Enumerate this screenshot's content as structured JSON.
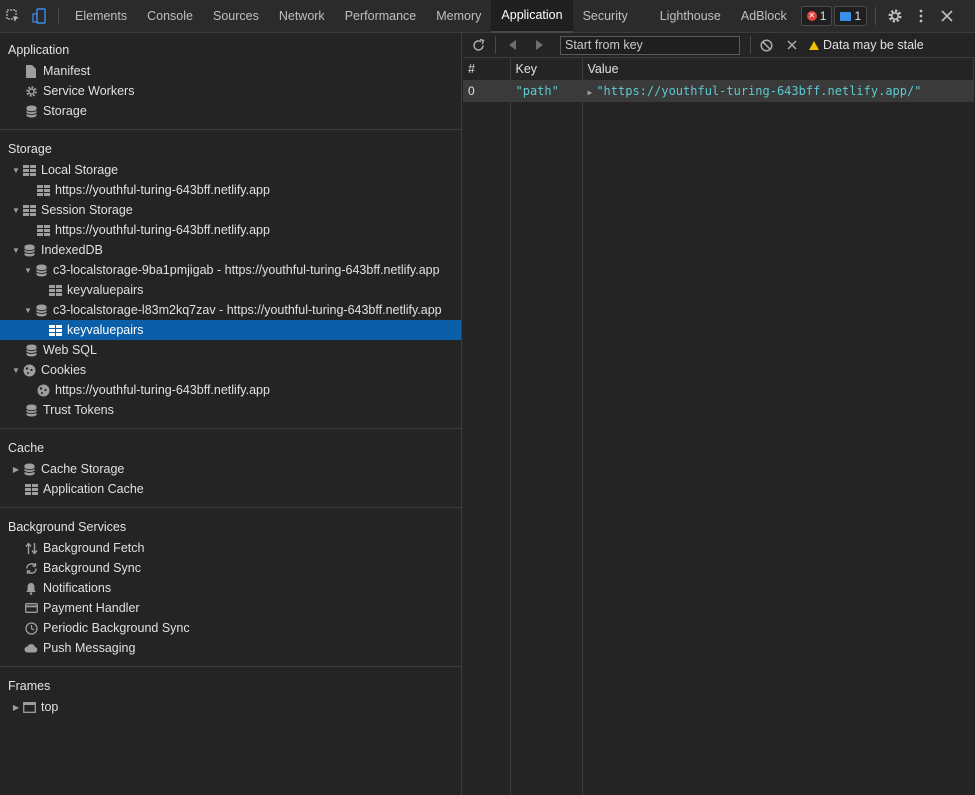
{
  "toolbar": {
    "tabs": [
      "Elements",
      "Console",
      "Sources",
      "Network",
      "Performance",
      "Memory",
      "Application",
      "Security",
      "Lighthouse",
      "AdBlock"
    ],
    "active_tab": "Application",
    "error_count": "1",
    "message_count": "1"
  },
  "sidebar": {
    "application": {
      "title": "Application",
      "items": [
        "Manifest",
        "Service Workers",
        "Storage"
      ]
    },
    "storage": {
      "title": "Storage",
      "local_storage": "Local Storage",
      "local_storage_origin": "https://youthful-turing-643bff.netlify.app",
      "session_storage": "Session Storage",
      "session_storage_origin": "https://youthful-turing-643bff.netlify.app",
      "indexeddb": "IndexedDB",
      "db1": "c3-localstorage-9ba1pmjigab - https://youthful-turing-643bff.netlify.app",
      "db1_store": "keyvaluepairs",
      "db2": "c3-localstorage-l83m2kq7zav - https://youthful-turing-643bff.netlify.app",
      "db2_store": "keyvaluepairs",
      "web_sql": "Web SQL",
      "cookies": "Cookies",
      "cookies_origin": "https://youthful-turing-643bff.netlify.app",
      "trust_tokens": "Trust Tokens"
    },
    "cache": {
      "title": "Cache",
      "items": [
        "Cache Storage",
        "Application Cache"
      ]
    },
    "background_services": {
      "title": "Background Services",
      "items": [
        "Background Fetch",
        "Background Sync",
        "Notifications",
        "Payment Handler",
        "Periodic Background Sync",
        "Push Messaging"
      ]
    },
    "frames": {
      "title": "Frames",
      "items": [
        "top"
      ]
    }
  },
  "panel": {
    "start_key_placeholder": "Start from key",
    "stale_text": "Data may be stale",
    "columns": [
      "#",
      "Key",
      "Value"
    ],
    "rows": [
      {
        "index": "0",
        "key": "\"path\"",
        "value": "\"https://youthful-turing-643bff.netlify.app/\""
      }
    ]
  }
}
